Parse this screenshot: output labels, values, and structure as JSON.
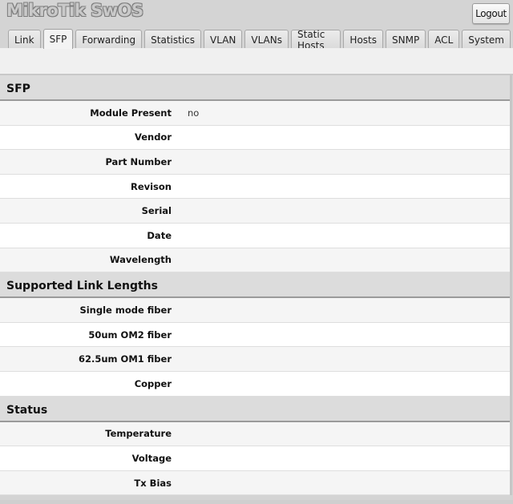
{
  "app": {
    "title": "MikroTik SwOS",
    "logout_label": "Logout"
  },
  "tabs": [
    {
      "label": "Link",
      "active": false
    },
    {
      "label": "SFP",
      "active": true
    },
    {
      "label": "Forwarding",
      "active": false
    },
    {
      "label": "Statistics",
      "active": false
    },
    {
      "label": "VLAN",
      "active": false
    },
    {
      "label": "VLANs",
      "active": false
    },
    {
      "label": "Static Hosts",
      "active": false
    },
    {
      "label": "Hosts",
      "active": false
    },
    {
      "label": "SNMP",
      "active": false
    },
    {
      "label": "ACL",
      "active": false
    },
    {
      "label": "System",
      "active": false
    }
  ],
  "sections": [
    {
      "title": "SFP",
      "rows": [
        {
          "label": "Module Present",
          "value": "no"
        },
        {
          "label": "Vendor",
          "value": ""
        },
        {
          "label": "Part Number",
          "value": ""
        },
        {
          "label": "Revison",
          "value": ""
        },
        {
          "label": "Serial",
          "value": ""
        },
        {
          "label": "Date",
          "value": ""
        },
        {
          "label": "Wavelength",
          "value": ""
        }
      ]
    },
    {
      "title": "Supported Link Lengths",
      "rows": [
        {
          "label": "Single mode fiber",
          "value": ""
        },
        {
          "label": "50um OM2 fiber",
          "value": ""
        },
        {
          "label": "62.5um OM1 fiber",
          "value": ""
        },
        {
          "label": "Copper",
          "value": ""
        }
      ]
    },
    {
      "title": "Status",
      "rows": [
        {
          "label": "Temperature",
          "value": ""
        },
        {
          "label": "Voltage",
          "value": ""
        },
        {
          "label": "Tx Bias",
          "value": ""
        }
      ]
    }
  ]
}
